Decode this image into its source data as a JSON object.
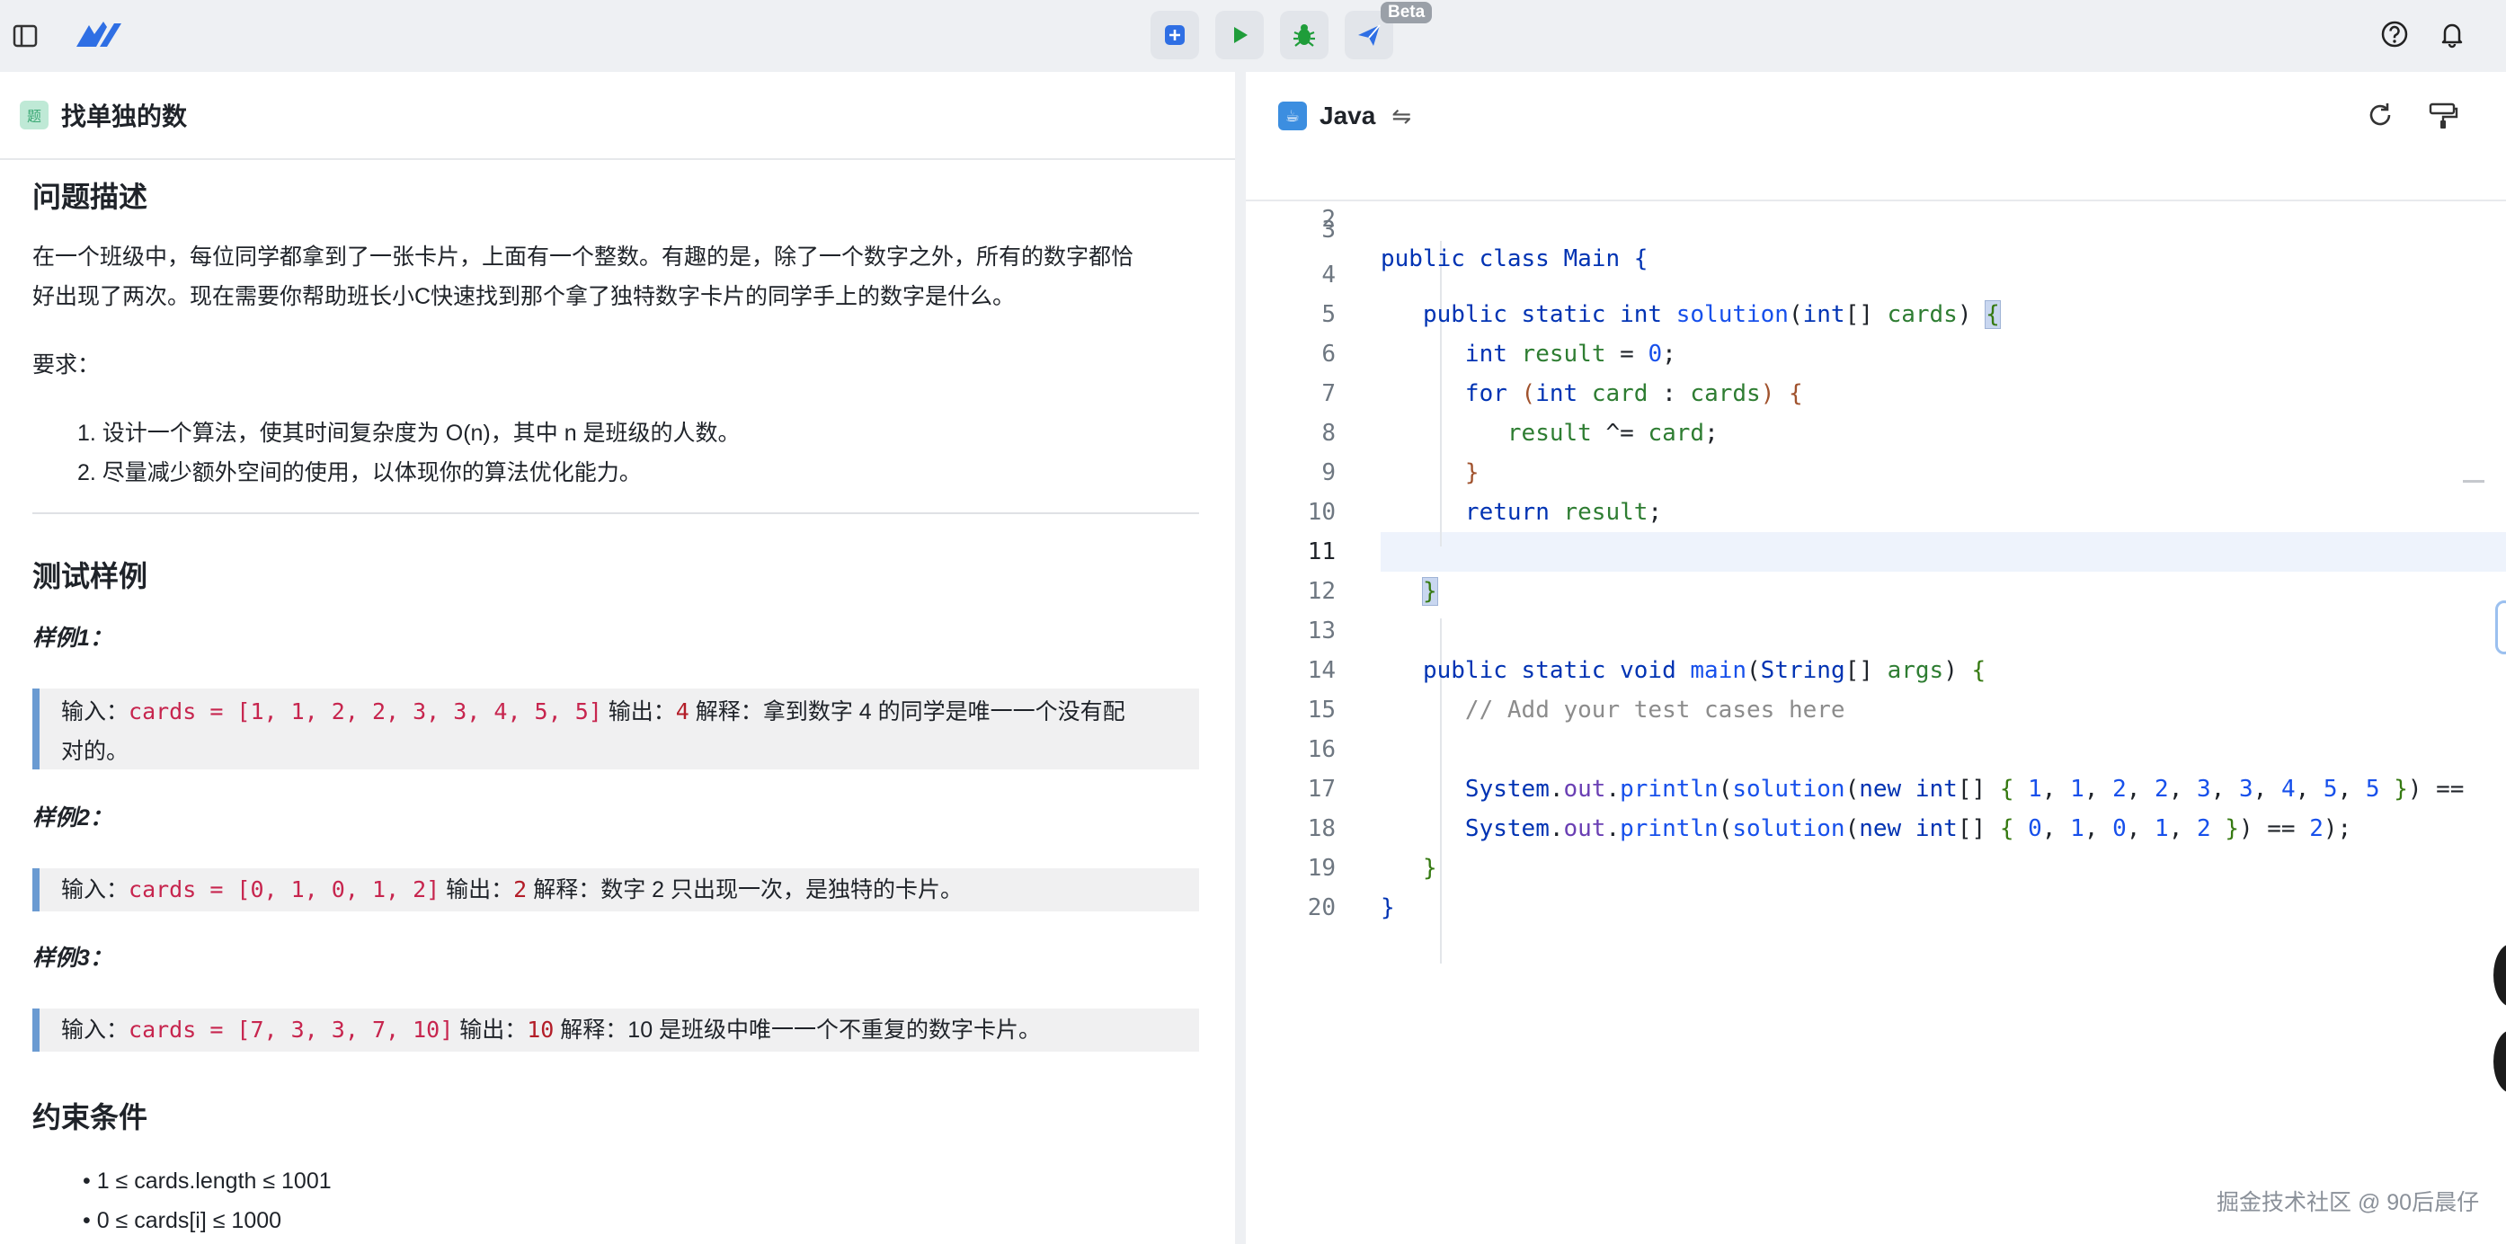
{
  "topbar": {
    "beta_label": "Beta"
  },
  "problem": {
    "tab_title": "找单独的数",
    "icon_glyph": "题",
    "desc_heading": "问题描述",
    "desc_p1_line1": "在一个班级中，每位同学都拿到了一张卡片，上面有一个整数。有趣的是，除了一个数字之外，所有的数字都恰",
    "desc_p1_line2": "好出现了两次。现在需要你帮助班长小C快速找到那个拿了独特数字卡片的同学手上的数字是什么。",
    "req_label": "要求：",
    "requirements": [
      "1. 设计一个算法，使其时间复杂度为 O(n)，其中 n 是班级的人数。",
      "2. 尽量减少额外空间的使用，以体现你的算法优化能力。"
    ],
    "examples_heading": "测试样例",
    "examples": [
      {
        "title": "样例1：",
        "in_label": "输入：",
        "input": "cards = [1, 1, 2, 2, 3, 3, 4, 5, 5]",
        "out_label": "输出：",
        "output": "4",
        "exp_label": "解释：",
        "explain_line1": "拿到数字 4 的同学是唯一一个没有配",
        "explain_line2": "对的。"
      },
      {
        "title": "样例2：",
        "in_label": "输入：",
        "input": "cards = [0, 1, 0, 1, 2]",
        "out_label": "输出：",
        "output": "2",
        "exp_label": "解释：",
        "explain_line1": "数字 2 只出现一次，是独特的卡片。"
      },
      {
        "title": "样例3：",
        "in_label": "输入：",
        "input": "cards = [7, 3, 3, 7, 10]",
        "out_label": "输出：",
        "output": "10",
        "exp_label": "解释：",
        "explain_line1": "10 是班级中唯一一个不重复的数字卡片。"
      }
    ],
    "constraints_heading": "约束条件",
    "constraints": [
      "1 ≤ cards.length ≤ 1001",
      "0 ≤ cards[i] ≤ 1000"
    ]
  },
  "editor": {
    "language": "Java",
    "switch_glyph": "⇋",
    "line_numbers": [
      "2",
      "3",
      "4",
      "5",
      "6",
      "7",
      "8",
      "9",
      "10",
      "11",
      "12",
      "13",
      "14",
      "15",
      "16",
      "17",
      "18",
      "19",
      "20"
    ],
    "active_line": "11"
  },
  "watermark": "掘金技术社区 @ 90后晨仔"
}
